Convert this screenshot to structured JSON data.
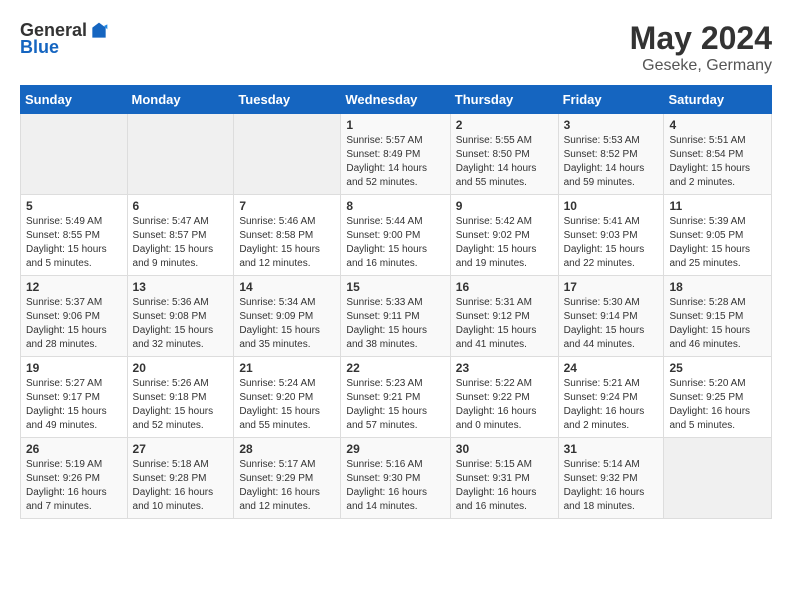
{
  "header": {
    "logo_general": "General",
    "logo_blue": "Blue",
    "month_year": "May 2024",
    "location": "Geseke, Germany"
  },
  "weekdays": [
    "Sunday",
    "Monday",
    "Tuesday",
    "Wednesday",
    "Thursday",
    "Friday",
    "Saturday"
  ],
  "weeks": [
    [
      {
        "day": "",
        "lines": []
      },
      {
        "day": "",
        "lines": []
      },
      {
        "day": "",
        "lines": []
      },
      {
        "day": "1",
        "lines": [
          "Sunrise: 5:57 AM",
          "Sunset: 8:49 PM",
          "Daylight: 14 hours",
          "and 52 minutes."
        ]
      },
      {
        "day": "2",
        "lines": [
          "Sunrise: 5:55 AM",
          "Sunset: 8:50 PM",
          "Daylight: 14 hours",
          "and 55 minutes."
        ]
      },
      {
        "day": "3",
        "lines": [
          "Sunrise: 5:53 AM",
          "Sunset: 8:52 PM",
          "Daylight: 14 hours",
          "and 59 minutes."
        ]
      },
      {
        "day": "4",
        "lines": [
          "Sunrise: 5:51 AM",
          "Sunset: 8:54 PM",
          "Daylight: 15 hours",
          "and 2 minutes."
        ]
      }
    ],
    [
      {
        "day": "5",
        "lines": [
          "Sunrise: 5:49 AM",
          "Sunset: 8:55 PM",
          "Daylight: 15 hours",
          "and 5 minutes."
        ]
      },
      {
        "day": "6",
        "lines": [
          "Sunrise: 5:47 AM",
          "Sunset: 8:57 PM",
          "Daylight: 15 hours",
          "and 9 minutes."
        ]
      },
      {
        "day": "7",
        "lines": [
          "Sunrise: 5:46 AM",
          "Sunset: 8:58 PM",
          "Daylight: 15 hours",
          "and 12 minutes."
        ]
      },
      {
        "day": "8",
        "lines": [
          "Sunrise: 5:44 AM",
          "Sunset: 9:00 PM",
          "Daylight: 15 hours",
          "and 16 minutes."
        ]
      },
      {
        "day": "9",
        "lines": [
          "Sunrise: 5:42 AM",
          "Sunset: 9:02 PM",
          "Daylight: 15 hours",
          "and 19 minutes."
        ]
      },
      {
        "day": "10",
        "lines": [
          "Sunrise: 5:41 AM",
          "Sunset: 9:03 PM",
          "Daylight: 15 hours",
          "and 22 minutes."
        ]
      },
      {
        "day": "11",
        "lines": [
          "Sunrise: 5:39 AM",
          "Sunset: 9:05 PM",
          "Daylight: 15 hours",
          "and 25 minutes."
        ]
      }
    ],
    [
      {
        "day": "12",
        "lines": [
          "Sunrise: 5:37 AM",
          "Sunset: 9:06 PM",
          "Daylight: 15 hours",
          "and 28 minutes."
        ]
      },
      {
        "day": "13",
        "lines": [
          "Sunrise: 5:36 AM",
          "Sunset: 9:08 PM",
          "Daylight: 15 hours",
          "and 32 minutes."
        ]
      },
      {
        "day": "14",
        "lines": [
          "Sunrise: 5:34 AM",
          "Sunset: 9:09 PM",
          "Daylight: 15 hours",
          "and 35 minutes."
        ]
      },
      {
        "day": "15",
        "lines": [
          "Sunrise: 5:33 AM",
          "Sunset: 9:11 PM",
          "Daylight: 15 hours",
          "and 38 minutes."
        ]
      },
      {
        "day": "16",
        "lines": [
          "Sunrise: 5:31 AM",
          "Sunset: 9:12 PM",
          "Daylight: 15 hours",
          "and 41 minutes."
        ]
      },
      {
        "day": "17",
        "lines": [
          "Sunrise: 5:30 AM",
          "Sunset: 9:14 PM",
          "Daylight: 15 hours",
          "and 44 minutes."
        ]
      },
      {
        "day": "18",
        "lines": [
          "Sunrise: 5:28 AM",
          "Sunset: 9:15 PM",
          "Daylight: 15 hours",
          "and 46 minutes."
        ]
      }
    ],
    [
      {
        "day": "19",
        "lines": [
          "Sunrise: 5:27 AM",
          "Sunset: 9:17 PM",
          "Daylight: 15 hours",
          "and 49 minutes."
        ]
      },
      {
        "day": "20",
        "lines": [
          "Sunrise: 5:26 AM",
          "Sunset: 9:18 PM",
          "Daylight: 15 hours",
          "and 52 minutes."
        ]
      },
      {
        "day": "21",
        "lines": [
          "Sunrise: 5:24 AM",
          "Sunset: 9:20 PM",
          "Daylight: 15 hours",
          "and 55 minutes."
        ]
      },
      {
        "day": "22",
        "lines": [
          "Sunrise: 5:23 AM",
          "Sunset: 9:21 PM",
          "Daylight: 15 hours",
          "and 57 minutes."
        ]
      },
      {
        "day": "23",
        "lines": [
          "Sunrise: 5:22 AM",
          "Sunset: 9:22 PM",
          "Daylight: 16 hours",
          "and 0 minutes."
        ]
      },
      {
        "day": "24",
        "lines": [
          "Sunrise: 5:21 AM",
          "Sunset: 9:24 PM",
          "Daylight: 16 hours",
          "and 2 minutes."
        ]
      },
      {
        "day": "25",
        "lines": [
          "Sunrise: 5:20 AM",
          "Sunset: 9:25 PM",
          "Daylight: 16 hours",
          "and 5 minutes."
        ]
      }
    ],
    [
      {
        "day": "26",
        "lines": [
          "Sunrise: 5:19 AM",
          "Sunset: 9:26 PM",
          "Daylight: 16 hours",
          "and 7 minutes."
        ]
      },
      {
        "day": "27",
        "lines": [
          "Sunrise: 5:18 AM",
          "Sunset: 9:28 PM",
          "Daylight: 16 hours",
          "and 10 minutes."
        ]
      },
      {
        "day": "28",
        "lines": [
          "Sunrise: 5:17 AM",
          "Sunset: 9:29 PM",
          "Daylight: 16 hours",
          "and 12 minutes."
        ]
      },
      {
        "day": "29",
        "lines": [
          "Sunrise: 5:16 AM",
          "Sunset: 9:30 PM",
          "Daylight: 16 hours",
          "and 14 minutes."
        ]
      },
      {
        "day": "30",
        "lines": [
          "Sunrise: 5:15 AM",
          "Sunset: 9:31 PM",
          "Daylight: 16 hours",
          "and 16 minutes."
        ]
      },
      {
        "day": "31",
        "lines": [
          "Sunrise: 5:14 AM",
          "Sunset: 9:32 PM",
          "Daylight: 16 hours",
          "and 18 minutes."
        ]
      },
      {
        "day": "",
        "lines": []
      }
    ]
  ]
}
